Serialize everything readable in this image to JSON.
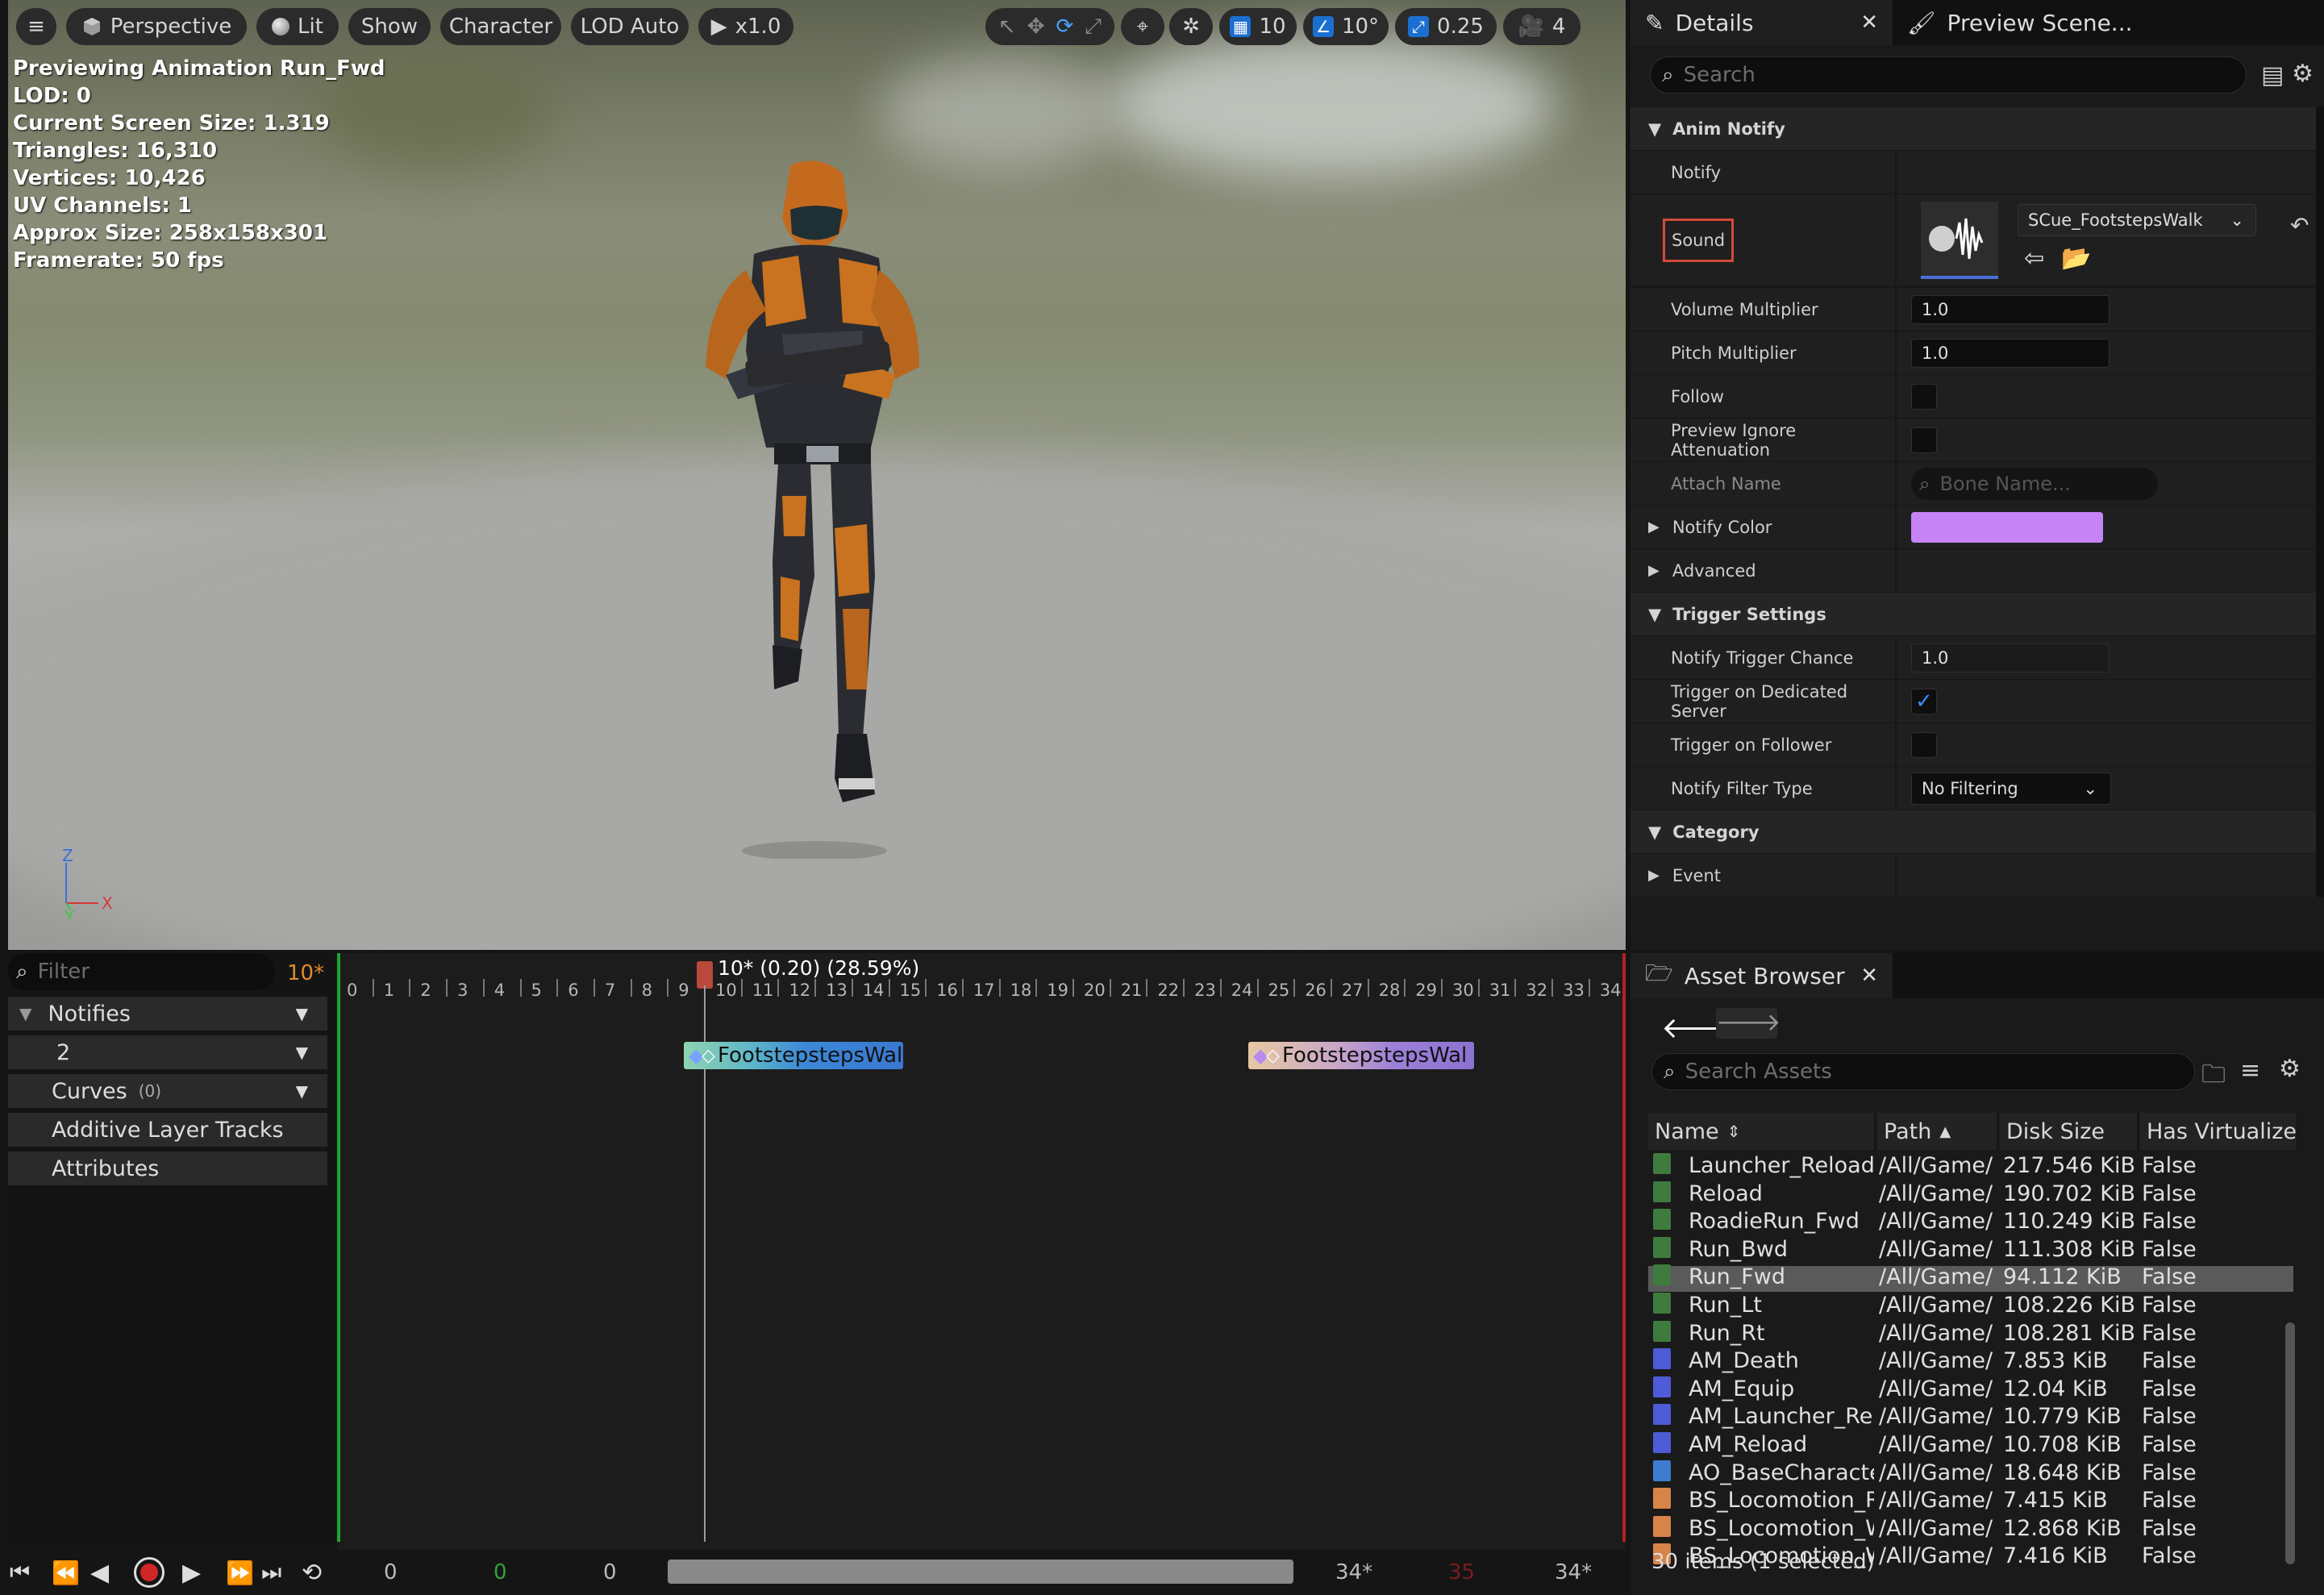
{
  "toolbar": {
    "perspective": "Perspective",
    "lit": "Lit",
    "show": "Show",
    "character": "Character",
    "lod": "LOD Auto",
    "play_speed": "x1.0",
    "grid_snap": "10",
    "angle_snap": "10°",
    "scale_snap": "0.25",
    "camera_speed": "4"
  },
  "stats": [
    "Previewing Animation Run_Fwd",
    "LOD: 0",
    "Current Screen Size: 1.319",
    "Triangles: 16,310",
    "Vertices: 10,426",
    "UV Channels: 1",
    "Approx Size: 258x158x301",
    "Framerate: 50 fps"
  ],
  "axis": {
    "z": "Z",
    "y": "Y",
    "x": "X"
  },
  "details": {
    "tab_details": "Details",
    "tab_preview": "Preview Scene...",
    "search_placeholder": "Search",
    "cat_anim_notify": "Anim Notify",
    "row_notify": "Notify",
    "row_sound": "Sound",
    "sound_asset": "SCue_FootstepsWalk",
    "row_volume": "Volume Multiplier",
    "volume": "1.0",
    "row_pitch": "Pitch Multiplier",
    "pitch": "1.0",
    "row_follow": "Follow",
    "row_preview_ignore": "Preview Ignore Attenuation",
    "row_attach": "Attach Name",
    "attach_placeholder": "Bone Name...",
    "row_notify_color": "Notify Color",
    "notify_color": "#c583f5",
    "row_advanced": "Advanced",
    "cat_trigger": "Trigger Settings",
    "row_trigger_chance": "Notify Trigger Chance",
    "trigger_chance": "1.0",
    "row_dedicated": "Trigger on Dedicated Server",
    "row_follower": "Trigger on Follower",
    "row_filter_type": "Notify Filter Type",
    "filter_type": "No Filtering",
    "cat_category": "Category",
    "row_event": "Event"
  },
  "timeline": {
    "filter_placeholder": "Filter",
    "frame_indicator": "10*",
    "tracks": {
      "notifies": "Notifies",
      "track_number": "2",
      "curves": "Curves",
      "curves_count": "(0)",
      "additive": "Additive Layer Tracks",
      "attributes": "Attributes"
    },
    "playhead_label": "10* (0.20) (28.59%)",
    "ticks": [
      "0",
      "1",
      "2",
      "3",
      "4",
      "5",
      "6",
      "7",
      "8",
      "9",
      "10",
      "11",
      "12",
      "13",
      "14",
      "15",
      "16",
      "17",
      "18",
      "19",
      "20",
      "21",
      "22",
      "23",
      "24",
      "25",
      "26",
      "27",
      "28",
      "29",
      "30",
      "31",
      "32",
      "33",
      "34"
    ],
    "notify1": "FootstepstepsWal",
    "notify2": "FootstepstepsWal",
    "transport": {
      "start": "0",
      "current": "0",
      "range_start": "0",
      "end1": "34*",
      "end_red": "35",
      "end2": "34*"
    }
  },
  "asset_browser": {
    "tab": "Asset Browser",
    "search_placeholder": "Search Assets",
    "columns": {
      "name": "Name",
      "path": "Path",
      "size": "Disk Size",
      "virtualized": "Has Virtualize"
    },
    "rows": [
      {
        "name": "Launcher_Reload",
        "path": "/All/Game/",
        "size": "217.546 KiB",
        "virt": "False",
        "kind": "anim"
      },
      {
        "name": "Reload",
        "path": "/All/Game/",
        "size": "190.702 KiB",
        "virt": "False",
        "kind": "anim"
      },
      {
        "name": "RoadieRun_Fwd",
        "path": "/All/Game/",
        "size": "110.249 KiB",
        "virt": "False",
        "kind": "anim"
      },
      {
        "name": "Run_Bwd",
        "path": "/All/Game/",
        "size": "111.308 KiB",
        "virt": "False",
        "kind": "anim"
      },
      {
        "name": "Run_Fwd",
        "path": "/All/Game/",
        "size": "94.112 KiB",
        "virt": "False",
        "kind": "anim-star"
      },
      {
        "name": "Run_Lt",
        "path": "/All/Game/",
        "size": "108.226 KiB",
        "virt": "False",
        "kind": "anim-star"
      },
      {
        "name": "Run_Rt",
        "path": "/All/Game/",
        "size": "108.281 KiB",
        "virt": "False",
        "kind": "anim-star"
      },
      {
        "name": "AM_Death",
        "path": "/All/Game/",
        "size": "7.853 KiB",
        "virt": "False",
        "kind": "montage"
      },
      {
        "name": "AM_Equip",
        "path": "/All/Game/",
        "size": "12.04 KiB",
        "virt": "False",
        "kind": "montage"
      },
      {
        "name": "AM_Launcher_Reloa",
        "path": "/All/Game/",
        "size": "10.779 KiB",
        "virt": "False",
        "kind": "montage"
      },
      {
        "name": "AM_Reload",
        "path": "/All/Game/",
        "size": "10.708 KiB",
        "virt": "False",
        "kind": "montage"
      },
      {
        "name": "AO_BaseCharacter",
        "path": "/All/Game/",
        "size": "18.648 KiB",
        "virt": "False",
        "kind": "aimoffset"
      },
      {
        "name": "BS_Locomotion_Ru",
        "path": "/All/Game/",
        "size": "7.415 KiB",
        "virt": "False",
        "kind": "blendspace"
      },
      {
        "name": "BS_Locomotion_Wa",
        "path": "/All/Game/",
        "size": "12.868 KiB",
        "virt": "False",
        "kind": "blendspace"
      },
      {
        "name": "BS_Locomotion_Wa",
        "path": "/All/Game/",
        "size": "7.416 KiB",
        "virt": "False",
        "kind": "blendspace"
      }
    ],
    "selected_name": "Run_Fwd",
    "status": "30 items (1 selected)"
  }
}
